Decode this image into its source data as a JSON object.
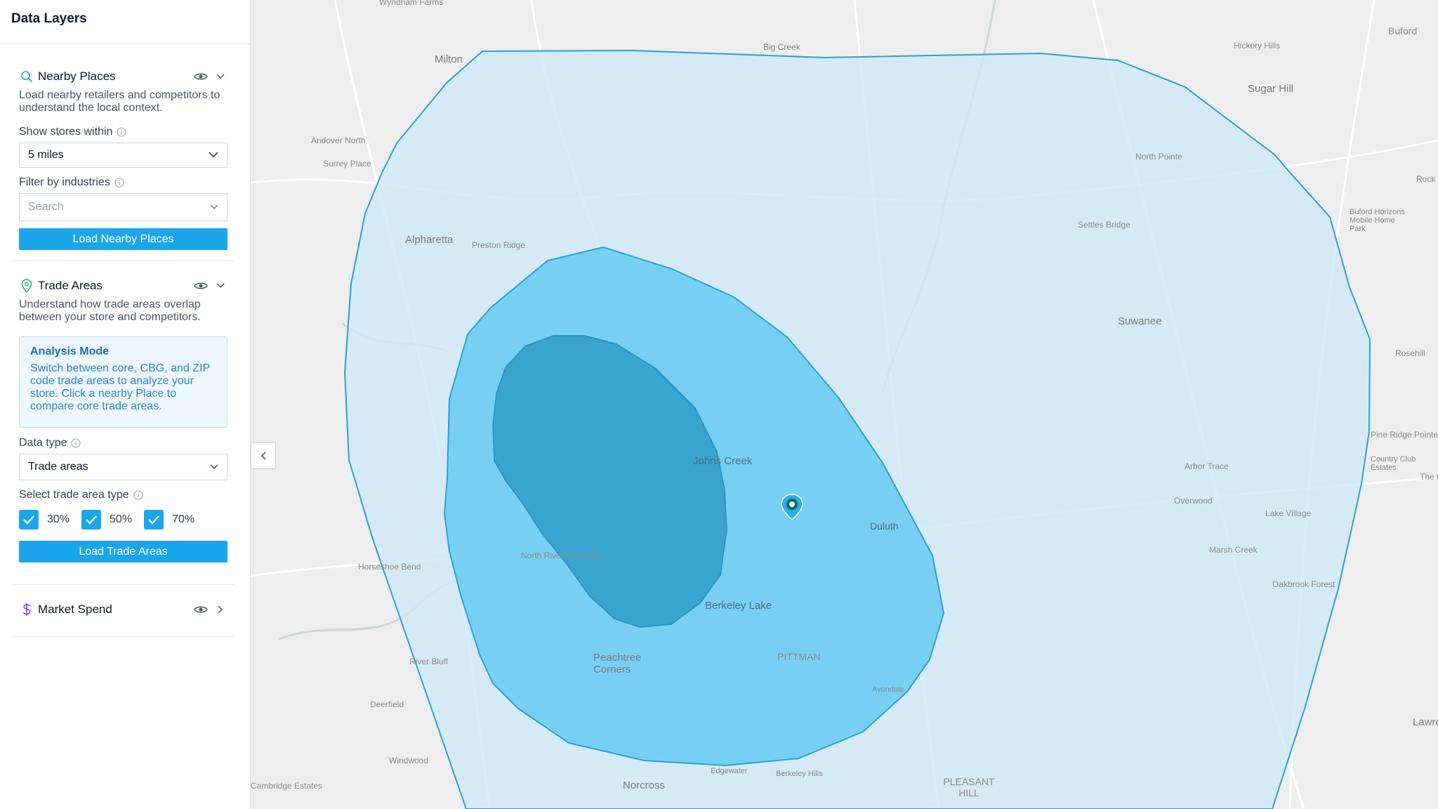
{
  "sidebar": {
    "title": "Data Layers",
    "nearby_places": {
      "icon": "search-icon",
      "title": "Nearby Places",
      "description": "Load nearby retailers and competitors to understand the local context.",
      "radius_label": "Show stores within",
      "radius_value": "5 miles",
      "industries_label": "Filter by industries",
      "industries_placeholder": "Search",
      "button": "Load Nearby Places"
    },
    "trade_areas": {
      "icon": "map-pin-icon",
      "title": "Trade Areas",
      "description": "Understand how trade areas overlap between your store and competitors.",
      "analysis_title": "Analysis Mode",
      "analysis_text": "Switch between core, CBG, and ZIP code trade areas to analyze your store. Click a nearby Place to compare core trade areas.",
      "data_type_label": "Data type",
      "data_type_value": "Trade areas",
      "type_label": "Select trade area type",
      "types": [
        {
          "label": "30%",
          "checked": true
        },
        {
          "label": "50%",
          "checked": true
        },
        {
          "label": "70%",
          "checked": true
        }
      ],
      "button": "Load Trade Areas"
    },
    "market_spend": {
      "icon": "dollar-icon",
      "title": "Market Spend"
    }
  },
  "map": {
    "labels": {
      "milton": "Milton",
      "sugar_hill": "Sugar Hill",
      "alpharetta": "Alpharetta",
      "suwanee": "Suwanee",
      "johns_creek": "Johns Creek",
      "duluth": "Duluth",
      "berkeley_lake": "Berkeley Lake",
      "peachtree_corners": "Peachtree Corners",
      "norcross": "Norcross",
      "lawrence": "Lawrenc",
      "pleasant_hill": "PLEASANT HILL",
      "pittman": "PITTMAN",
      "buford": "Buford",
      "wyndham": "Wyndham Farms",
      "big_creek": "Big Creek",
      "hickory_hills": "Hickory Hills",
      "andover_north": "Andover North",
      "surrey_place": "Surrey Place",
      "north_pointe": "North Pointe",
      "preston_ridge": "Preston Ridge",
      "settles_bridge": "Settles Bridge",
      "rock_c": "Rock C",
      "buford_horizons": "Buford Horizons Mobile Home Park",
      "rosehill": "Rosehill",
      "pine_ridge": "Pine Ridge Pointe",
      "country_club": "Country Club Estates",
      "the_c": "The C",
      "arbor_trace": "Arbor Trace",
      "overwood": "Overwood",
      "lake_village": "Lake Village",
      "north_river": "North River Crossing",
      "horseshoe": "Horseshoe Bend",
      "marsh_creek": "Marsh Creek",
      "oakbrook": "Oakbrook Forest",
      "deerfield": "Deerfield",
      "windwood": "Windwood",
      "cambridge": "Cambridge Estates",
      "river_bluff": "River Bluff",
      "edgewater": "Edgewater",
      "berkeley_hills": "Berkeley Hills",
      "avondale": "Avondale"
    },
    "colors": {
      "area_70": "#cfe9f7",
      "area_50": "#72cff3",
      "area_30": "#2d9cc8",
      "edge": "#2aa1d3",
      "marker": "#2ab0e8"
    },
    "store_marker_icon": "starbucks-pin-icon"
  },
  "collapse_icon": "chevron-left-icon"
}
